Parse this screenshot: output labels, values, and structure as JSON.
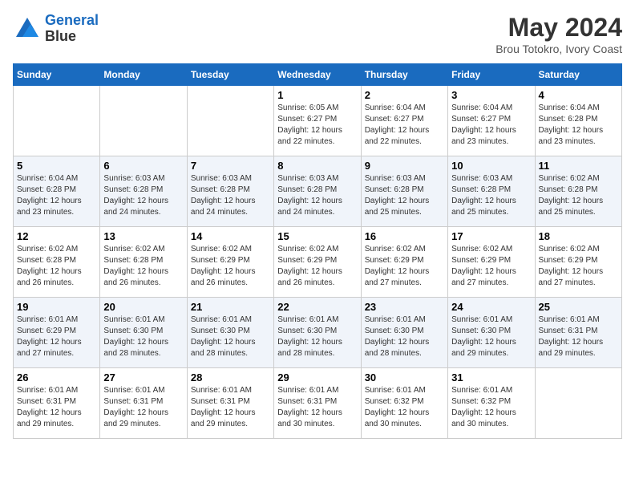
{
  "header": {
    "logo_line1": "General",
    "logo_line2": "Blue",
    "month": "May 2024",
    "location": "Brou Totokro, Ivory Coast"
  },
  "days_of_week": [
    "Sunday",
    "Monday",
    "Tuesday",
    "Wednesday",
    "Thursday",
    "Friday",
    "Saturday"
  ],
  "weeks": [
    [
      {
        "day": "",
        "info": ""
      },
      {
        "day": "",
        "info": ""
      },
      {
        "day": "",
        "info": ""
      },
      {
        "day": "1",
        "info": "Sunrise: 6:05 AM\nSunset: 6:27 PM\nDaylight: 12 hours\nand 22 minutes."
      },
      {
        "day": "2",
        "info": "Sunrise: 6:04 AM\nSunset: 6:27 PM\nDaylight: 12 hours\nand 22 minutes."
      },
      {
        "day": "3",
        "info": "Sunrise: 6:04 AM\nSunset: 6:27 PM\nDaylight: 12 hours\nand 23 minutes."
      },
      {
        "day": "4",
        "info": "Sunrise: 6:04 AM\nSunset: 6:28 PM\nDaylight: 12 hours\nand 23 minutes."
      }
    ],
    [
      {
        "day": "5",
        "info": "Sunrise: 6:04 AM\nSunset: 6:28 PM\nDaylight: 12 hours\nand 23 minutes."
      },
      {
        "day": "6",
        "info": "Sunrise: 6:03 AM\nSunset: 6:28 PM\nDaylight: 12 hours\nand 24 minutes."
      },
      {
        "day": "7",
        "info": "Sunrise: 6:03 AM\nSunset: 6:28 PM\nDaylight: 12 hours\nand 24 minutes."
      },
      {
        "day": "8",
        "info": "Sunrise: 6:03 AM\nSunset: 6:28 PM\nDaylight: 12 hours\nand 24 minutes."
      },
      {
        "day": "9",
        "info": "Sunrise: 6:03 AM\nSunset: 6:28 PM\nDaylight: 12 hours\nand 25 minutes."
      },
      {
        "day": "10",
        "info": "Sunrise: 6:03 AM\nSunset: 6:28 PM\nDaylight: 12 hours\nand 25 minutes."
      },
      {
        "day": "11",
        "info": "Sunrise: 6:02 AM\nSunset: 6:28 PM\nDaylight: 12 hours\nand 25 minutes."
      }
    ],
    [
      {
        "day": "12",
        "info": "Sunrise: 6:02 AM\nSunset: 6:28 PM\nDaylight: 12 hours\nand 26 minutes."
      },
      {
        "day": "13",
        "info": "Sunrise: 6:02 AM\nSunset: 6:28 PM\nDaylight: 12 hours\nand 26 minutes."
      },
      {
        "day": "14",
        "info": "Sunrise: 6:02 AM\nSunset: 6:29 PM\nDaylight: 12 hours\nand 26 minutes."
      },
      {
        "day": "15",
        "info": "Sunrise: 6:02 AM\nSunset: 6:29 PM\nDaylight: 12 hours\nand 26 minutes."
      },
      {
        "day": "16",
        "info": "Sunrise: 6:02 AM\nSunset: 6:29 PM\nDaylight: 12 hours\nand 27 minutes."
      },
      {
        "day": "17",
        "info": "Sunrise: 6:02 AM\nSunset: 6:29 PM\nDaylight: 12 hours\nand 27 minutes."
      },
      {
        "day": "18",
        "info": "Sunrise: 6:02 AM\nSunset: 6:29 PM\nDaylight: 12 hours\nand 27 minutes."
      }
    ],
    [
      {
        "day": "19",
        "info": "Sunrise: 6:01 AM\nSunset: 6:29 PM\nDaylight: 12 hours\nand 27 minutes."
      },
      {
        "day": "20",
        "info": "Sunrise: 6:01 AM\nSunset: 6:30 PM\nDaylight: 12 hours\nand 28 minutes."
      },
      {
        "day": "21",
        "info": "Sunrise: 6:01 AM\nSunset: 6:30 PM\nDaylight: 12 hours\nand 28 minutes."
      },
      {
        "day": "22",
        "info": "Sunrise: 6:01 AM\nSunset: 6:30 PM\nDaylight: 12 hours\nand 28 minutes."
      },
      {
        "day": "23",
        "info": "Sunrise: 6:01 AM\nSunset: 6:30 PM\nDaylight: 12 hours\nand 28 minutes."
      },
      {
        "day": "24",
        "info": "Sunrise: 6:01 AM\nSunset: 6:30 PM\nDaylight: 12 hours\nand 29 minutes."
      },
      {
        "day": "25",
        "info": "Sunrise: 6:01 AM\nSunset: 6:31 PM\nDaylight: 12 hours\nand 29 minutes."
      }
    ],
    [
      {
        "day": "26",
        "info": "Sunrise: 6:01 AM\nSunset: 6:31 PM\nDaylight: 12 hours\nand 29 minutes."
      },
      {
        "day": "27",
        "info": "Sunrise: 6:01 AM\nSunset: 6:31 PM\nDaylight: 12 hours\nand 29 minutes."
      },
      {
        "day": "28",
        "info": "Sunrise: 6:01 AM\nSunset: 6:31 PM\nDaylight: 12 hours\nand 29 minutes."
      },
      {
        "day": "29",
        "info": "Sunrise: 6:01 AM\nSunset: 6:31 PM\nDaylight: 12 hours\nand 30 minutes."
      },
      {
        "day": "30",
        "info": "Sunrise: 6:01 AM\nSunset: 6:32 PM\nDaylight: 12 hours\nand 30 minutes."
      },
      {
        "day": "31",
        "info": "Sunrise: 6:01 AM\nSunset: 6:32 PM\nDaylight: 12 hours\nand 30 minutes."
      },
      {
        "day": "",
        "info": ""
      }
    ]
  ]
}
